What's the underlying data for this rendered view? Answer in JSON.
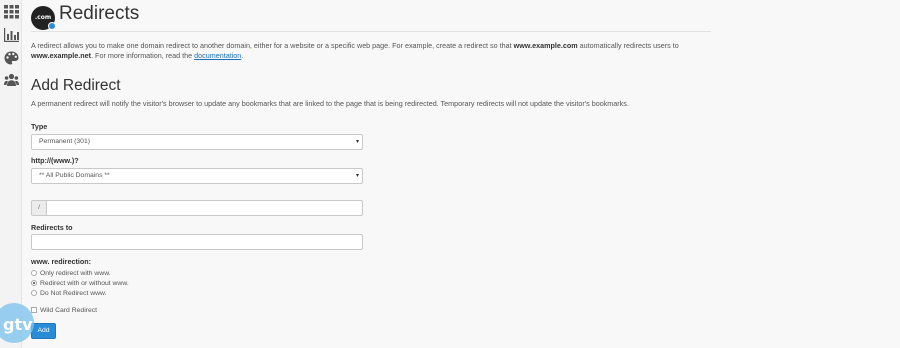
{
  "sidebar": {
    "items": [
      {
        "icon": "grid-icon",
        "label": ""
      },
      {
        "icon": "bar-chart-icon",
        "label": ""
      },
      {
        "icon": "palette-icon",
        "label": ""
      },
      {
        "icon": "users-icon",
        "label": ""
      }
    ]
  },
  "header": {
    "logo_text": ".com",
    "title": "Redirects"
  },
  "intro": {
    "text_1": "A redirect allows you to make one domain redirect to another domain, either for a website or a specific web page. For example, create a redirect so that ",
    "bold_1": "www.example.com",
    "text_2": " automatically redirects users to ",
    "bold_2": "www.example.net",
    "text_3": ". For more information, read the ",
    "link": "documentation",
    "text_4": "."
  },
  "form": {
    "heading": "Add Redirect",
    "lead": "A permanent redirect will notify the visitor's browser to update any bookmarks that are linked to the page that is being redirected. Temporary redirects will not update the visitor's bookmarks.",
    "type_label": "Type",
    "type_value": "Permanent (301)",
    "domain_label": "http://(www.)?",
    "domain_value": "** All Public Domains **",
    "path_prefix": "/",
    "path_value": "",
    "redirects_to_label": "Redirects to",
    "redirects_to_value": "",
    "www_label": "www. redirection:",
    "www_options": [
      {
        "label": "Only redirect with www.",
        "selected": false
      },
      {
        "label": "Redirect with or without www.",
        "selected": true
      },
      {
        "label": "Do Not Redirect www.",
        "selected": false
      }
    ],
    "wildcard_label": "Wild Card Redirect",
    "wildcard_checked": false,
    "submit_label": "Add"
  },
  "watermark": {
    "text": "gtv"
  },
  "colors": {
    "accent": "#2a8bd6",
    "link": "#1a6fb8",
    "background": "#f8f8f8"
  }
}
